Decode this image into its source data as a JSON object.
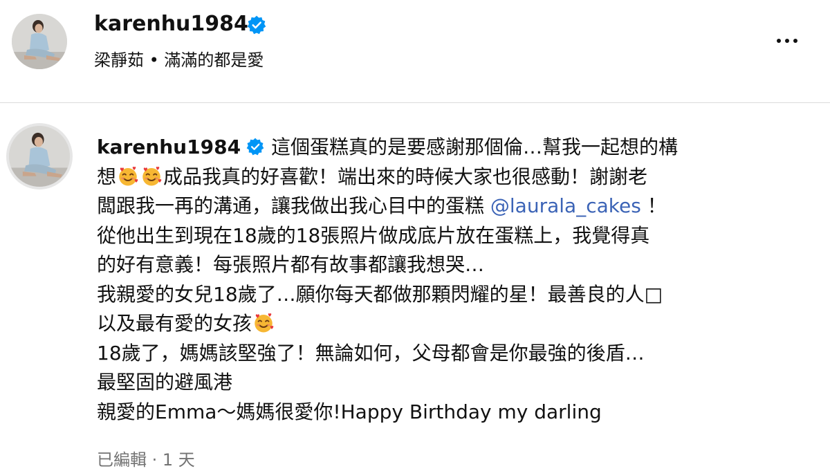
{
  "header": {
    "username": "karenhu1984",
    "subtitle": "梁靜茹 • 滿滿的都是愛",
    "more_label": "More options"
  },
  "comment": {
    "username": "karenhu1984",
    "caption_lines": [
      "這個蛋糕真的是要感謝那個倫…幫我一起想的構",
      "想",
      "成品我真的好喜歡！端出來的時候大家也很感動！謝謝老",
      "闆跟我一再的溝通，讓我做出我心目中的蛋糕 ",
      "@laurala_cakes",
      " ！",
      "從他出生到現在18歲的18張照片做成底片放在蛋糕上，我覺得真",
      "的好有意義！每張照片都有故事都讓我想哭…",
      "我親愛的女兒18歲了…願你每天都做那顆閃耀的星！最善良的人",
      "□",
      "以及最有愛的女孩",
      "18歲了，媽媽該堅強了！無論如何，父母都會是你最強的後盾…",
      "最堅固的避風港",
      "親愛的Emma～媽媽很愛你!Happy Birthday my darling"
    ],
    "meta": "已編輯 · 1 天"
  },
  "colors": {
    "verified_badge": "#0095f6",
    "mention": "#3b63b6",
    "meta_text": "#737373",
    "divider": "#dbdbdb",
    "emoji_face": "#f7b733",
    "emoji_heart": "#e83a3a"
  },
  "icons": {
    "verified": "verified-badge-icon",
    "emoji": "smiling-face-with-hearts-emoji",
    "more": "more-horizontal-icon"
  }
}
